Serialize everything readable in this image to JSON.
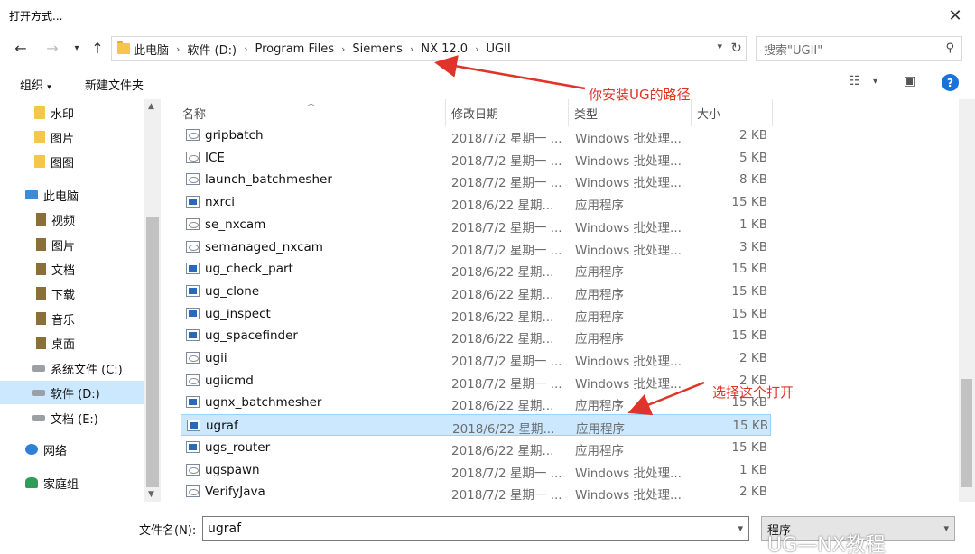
{
  "window": {
    "title": "打开方式..."
  },
  "address": {
    "crumbs": [
      "此电脑",
      "软件 (D:)",
      "Program Files",
      "Siemens",
      "NX 12.0",
      "UGII"
    ]
  },
  "search": {
    "placeholder": "搜索\"UGII\""
  },
  "toolbar": {
    "organize": "组织",
    "new_folder": "新建文件夹",
    "help": "?"
  },
  "sidebar": {
    "items": [
      {
        "label": "水印",
        "icon": "folder-icon"
      },
      {
        "label": "图片",
        "icon": "folder-icon"
      },
      {
        "label": "图图",
        "icon": "folder-icon"
      },
      {
        "label": "此电脑",
        "icon": "computer-icon"
      },
      {
        "label": "视频",
        "icon": "video-library-icon"
      },
      {
        "label": "图片",
        "icon": "picture-library-icon"
      },
      {
        "label": "文档",
        "icon": "document-library-icon"
      },
      {
        "label": "下载",
        "icon": "download-icon"
      },
      {
        "label": "音乐",
        "icon": "music-icon"
      },
      {
        "label": "桌面",
        "icon": "desktop-icon"
      },
      {
        "label": "系统文件 (C:)",
        "icon": "drive-icon"
      },
      {
        "label": "软件 (D:)",
        "icon": "drive-icon"
      },
      {
        "label": "文档 (E:)",
        "icon": "drive-icon"
      },
      {
        "label": "网络",
        "icon": "network-icon"
      },
      {
        "label": "家庭组",
        "icon": "homegroup-icon"
      }
    ]
  },
  "columns": {
    "name": "名称",
    "date": "修改日期",
    "type": "类型",
    "size": "大小"
  },
  "files": [
    {
      "name": "gripbatch",
      "date": "2018/7/2 星期一 ...",
      "type": "Windows 批处理...",
      "size": "2 KB",
      "kind": "bat"
    },
    {
      "name": "ICE",
      "date": "2018/7/2 星期一 ...",
      "type": "Windows 批处理...",
      "size": "5 KB",
      "kind": "bat"
    },
    {
      "name": "launch_batchmesher",
      "date": "2018/7/2 星期一 ...",
      "type": "Windows 批处理...",
      "size": "8 KB",
      "kind": "bat"
    },
    {
      "name": "nxrci",
      "date": "2018/6/22 星期...",
      "type": "应用程序",
      "size": "15 KB",
      "kind": "app"
    },
    {
      "name": "se_nxcam",
      "date": "2018/7/2 星期一 ...",
      "type": "Windows 批处理...",
      "size": "1 KB",
      "kind": "bat"
    },
    {
      "name": "semanaged_nxcam",
      "date": "2018/7/2 星期一 ...",
      "type": "Windows 批处理...",
      "size": "3 KB",
      "kind": "bat"
    },
    {
      "name": "ug_check_part",
      "date": "2018/6/22 星期...",
      "type": "应用程序",
      "size": "15 KB",
      "kind": "app"
    },
    {
      "name": "ug_clone",
      "date": "2018/6/22 星期...",
      "type": "应用程序",
      "size": "15 KB",
      "kind": "app"
    },
    {
      "name": "ug_inspect",
      "date": "2018/6/22 星期...",
      "type": "应用程序",
      "size": "15 KB",
      "kind": "app"
    },
    {
      "name": "ug_spacefinder",
      "date": "2018/6/22 星期...",
      "type": "应用程序",
      "size": "15 KB",
      "kind": "app"
    },
    {
      "name": "ugii",
      "date": "2018/7/2 星期一 ...",
      "type": "Windows 批处理...",
      "size": "2 KB",
      "kind": "bat"
    },
    {
      "name": "ugiicmd",
      "date": "2018/7/2 星期一 ...",
      "type": "Windows 批处理...",
      "size": "2 KB",
      "kind": "bat"
    },
    {
      "name": "ugnx_batchmesher",
      "date": "2018/6/22 星期...",
      "type": "应用程序",
      "size": "15 KB",
      "kind": "app"
    },
    {
      "name": "ugraf",
      "date": "2018/6/22 星期...",
      "type": "应用程序",
      "size": "15 KB",
      "kind": "app"
    },
    {
      "name": "ugs_router",
      "date": "2018/6/22 星期...",
      "type": "应用程序",
      "size": "15 KB",
      "kind": "app"
    },
    {
      "name": "ugspawn",
      "date": "2018/7/2 星期一 ...",
      "type": "Windows 批处理...",
      "size": "1 KB",
      "kind": "bat"
    },
    {
      "name": "VerifyJava",
      "date": "2018/7/2 星期一 ...",
      "type": "Windows 批处理...",
      "size": "2 KB",
      "kind": "bat"
    }
  ],
  "selected_file_index": 13,
  "bottom": {
    "filename_label": "文件名(N):",
    "filename_value": "ugraf",
    "filetype_value": "程序"
  },
  "annotations": {
    "path_note": "你安装UG的路径",
    "open_note": "选择这个打开",
    "color": "#e0342a"
  },
  "watermark": "UG—NX教程"
}
